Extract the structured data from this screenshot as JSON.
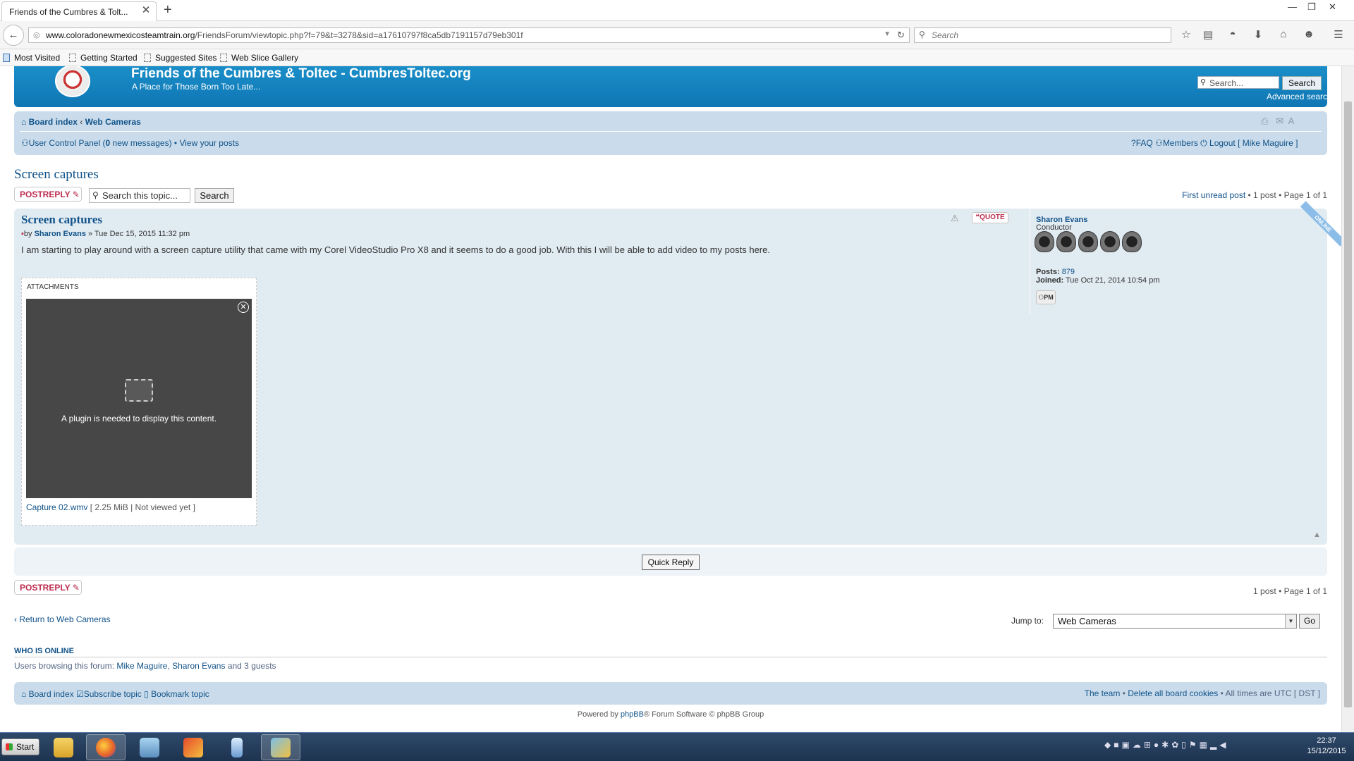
{
  "browser": {
    "tab_title": "Friends of the Cumbres & Tolt...",
    "url_domain": "www.coloradonewmexicosteamtrain.org",
    "url_path": "/FriendsForum/viewtopic.php?f=79&t=3278&sid=a17610797f8ca5db7191157d79eb301f",
    "search_placeholder": "Search",
    "bookmarks": [
      "Most Visited",
      "Getting Started",
      "Suggested Sites",
      "Web Slice Gallery"
    ]
  },
  "site": {
    "title": "Friends of the Cumbres & Toltec - CumbresToltec.org",
    "description": "A Place for Those Born Too Late...",
    "search_placeholder": "Search...",
    "search_button": "Search",
    "advanced_search": "Advanced search"
  },
  "nav": {
    "board_index": "Board index",
    "crumb_sep": "‹",
    "forum": "Web Cameras",
    "ucp": "User Control Panel",
    "ucp_count_open": "(",
    "new_msg_count": "0",
    "new_msg_text": "new messages)",
    "bullet": "•",
    "view_posts": "View your posts",
    "faq": "FAQ",
    "members": "Members",
    "logout": "Logout",
    "user_bracket": "[ Mike Maguire ]"
  },
  "topic": {
    "title": "Screen captures",
    "post_reply": "POSTREPLY",
    "search_placeholder": "Search this topic...",
    "search_button": "Search",
    "first_unread": "First unread post",
    "pagination": "• 1 post • Page 1 of 1",
    "pagination_bottom": "1 post • Page 1 of 1"
  },
  "post": {
    "title": "Screen captures",
    "by": "by",
    "author": "Sharon Evans",
    "date": "» Tue Dec 15, 2015 11:32 pm",
    "body": "I am starting to play around with a screen capture utility that came with my Corel VideoStudio Pro X8 and it seems to do a good job. With this I will be able to add video to my posts here.",
    "quote_button": "QUOTE",
    "attachments_label": "ATTACHMENTS",
    "plugin_message": "A plugin is needed to display this content.",
    "attachment_name": "Capture 02.wmv",
    "attachment_meta": "[ 2.25 MiB | Not viewed yet ]",
    "online_label": "ONLINE"
  },
  "profile": {
    "name": "Sharon Evans",
    "rank": "Conductor",
    "posts_label": "Posts:",
    "posts": "879",
    "joined_label": "Joined:",
    "joined": "Tue Oct 21, 2014 10:54 pm",
    "pm_button": "PM"
  },
  "bottom": {
    "quick_reply": "Quick Reply",
    "return_text": "Return to Web Cameras",
    "jump_label": "Jump to:",
    "jump_value": "Web Cameras",
    "go_button": "Go",
    "who_online_title": "WHO IS ONLINE",
    "who_online_prefix": "Users browsing this forum:",
    "user1": "Mike Maguire",
    "user2": "Sharon Evans",
    "who_online_suffix": "and 3 guests",
    "footer_board_index": "Board index",
    "subscribe": "Subscribe topic",
    "bookmark": "Bookmark topic",
    "the_team": "The team",
    "delete_cookies": "Delete all board cookies",
    "times_text": "• All times are UTC [ DST ]",
    "powered_pre": "Powered by",
    "phpbb": "phpBB",
    "powered_post": "® Forum Software © phpBB Group"
  },
  "taskbar": {
    "start": "Start",
    "time": "22:37",
    "date": "15/12/2015"
  },
  "colors": {
    "header_blue": "#1a8ec8",
    "link_blue": "#105289",
    "nav_bg": "#cadceb",
    "post_bg": "#e1ebf2",
    "reply_red": "#bc2a4d"
  }
}
